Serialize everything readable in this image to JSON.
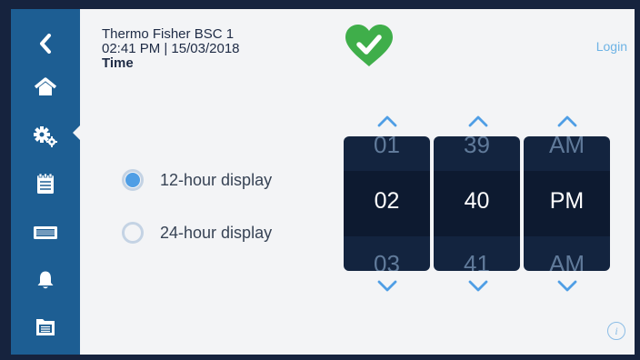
{
  "header": {
    "device_name": "Thermo Fisher BSC 1",
    "datetime": "02:41 PM | 15/03/2018",
    "screen_title": "Time",
    "status_icon": "heart-check-icon",
    "login_label": "Login"
  },
  "sidebar": {
    "items": [
      {
        "name": "back",
        "icon": "chevron-left-icon"
      },
      {
        "name": "home",
        "icon": "home-icon"
      },
      {
        "name": "settings",
        "icon": "gears-icon",
        "selected": true
      },
      {
        "name": "log",
        "icon": "clipboard-icon"
      },
      {
        "name": "display",
        "icon": "monitor-icon"
      },
      {
        "name": "alarms",
        "icon": "bell-icon"
      },
      {
        "name": "files",
        "icon": "files-icon"
      }
    ]
  },
  "display_format": {
    "options": [
      {
        "label": "12-hour display",
        "selected": true
      },
      {
        "label": "24-hour display",
        "selected": false
      }
    ]
  },
  "time_picker": {
    "hour": {
      "prev": "01",
      "current": "02",
      "next": "03"
    },
    "minute": {
      "prev": "39",
      "current": "40",
      "next": "41"
    },
    "ampm": {
      "prev": "AM",
      "current": "PM",
      "next": "AM"
    }
  },
  "colors": {
    "sidebar": "#1d5e93",
    "background": "#f3f4f6",
    "wheel": "#13243f",
    "accent": "#4f9ee5",
    "status_ok": "#3fae4a"
  }
}
